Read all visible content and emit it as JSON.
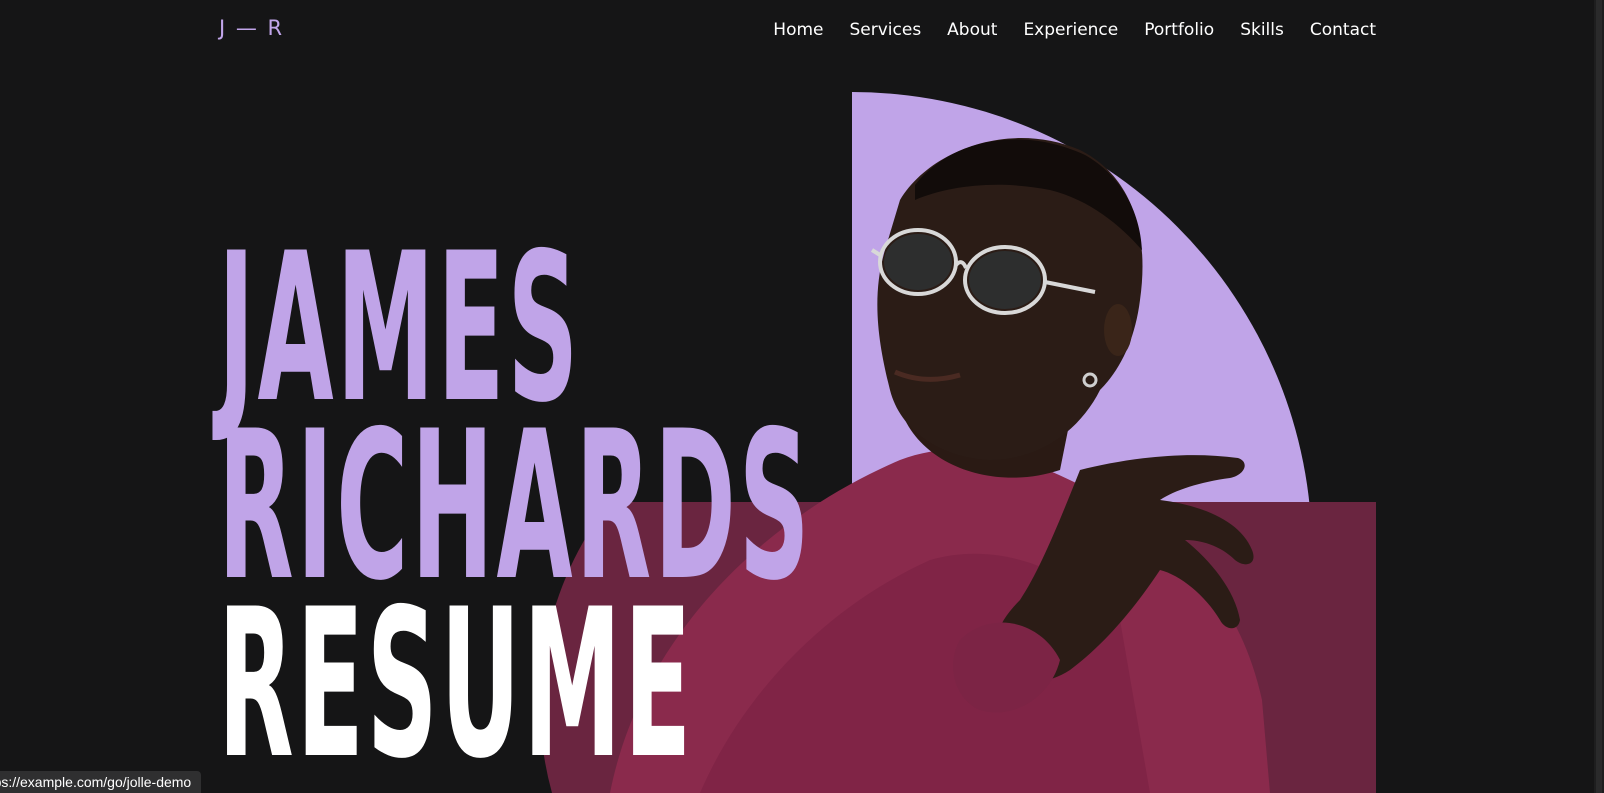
{
  "header": {
    "logo_text": "J — R",
    "nav": [
      {
        "label": "Home"
      },
      {
        "label": "Services"
      },
      {
        "label": "About"
      },
      {
        "label": "Experience"
      },
      {
        "label": "Portfolio"
      },
      {
        "label": "Skills"
      },
      {
        "label": "Contact"
      }
    ]
  },
  "hero": {
    "line1": "JAMES",
    "line2": "RICHARDS",
    "line3": "RESUME"
  },
  "status_bar": {
    "url_text": "https://example.com/go/jolle-demo"
  },
  "colors": {
    "background": "#151516",
    "accent_purple": "#c0a4e8",
    "accent_wine": "#6a2540",
    "text_white": "#ffffff"
  }
}
